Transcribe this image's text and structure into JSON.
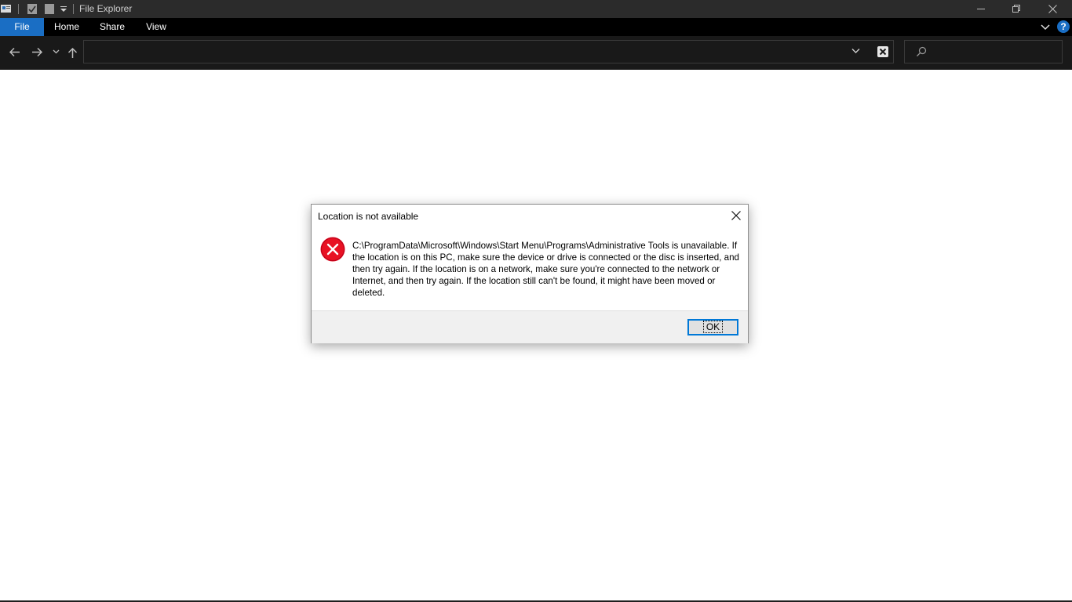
{
  "window": {
    "title": "File Explorer"
  },
  "ribbon": {
    "tabs": [
      {
        "label": "File",
        "active": true
      },
      {
        "label": "Home"
      },
      {
        "label": "Share"
      },
      {
        "label": "View"
      }
    ],
    "help_label": "?"
  },
  "navigation": {
    "address_value": "",
    "search_placeholder": ""
  },
  "dialog": {
    "title": "Location is not available",
    "message": "C:\\ProgramData\\Microsoft\\Windows\\Start Menu\\Programs\\Administrative Tools is unavailable. If the location is on this PC, make sure the device or drive is connected or the disc is inserted, and then try again. If the location is on a network, make sure you're connected to the network or Internet, and then try again. If the location still can't be found, it might have been moved or deleted.",
    "ok_label": "OK",
    "icon": "error-icon"
  },
  "colors": {
    "accent": "#1a6ec4",
    "titlebar": "#2b2b2b",
    "ribbon": "#000000",
    "navbar": "#191919",
    "error_red": "#e81123"
  }
}
